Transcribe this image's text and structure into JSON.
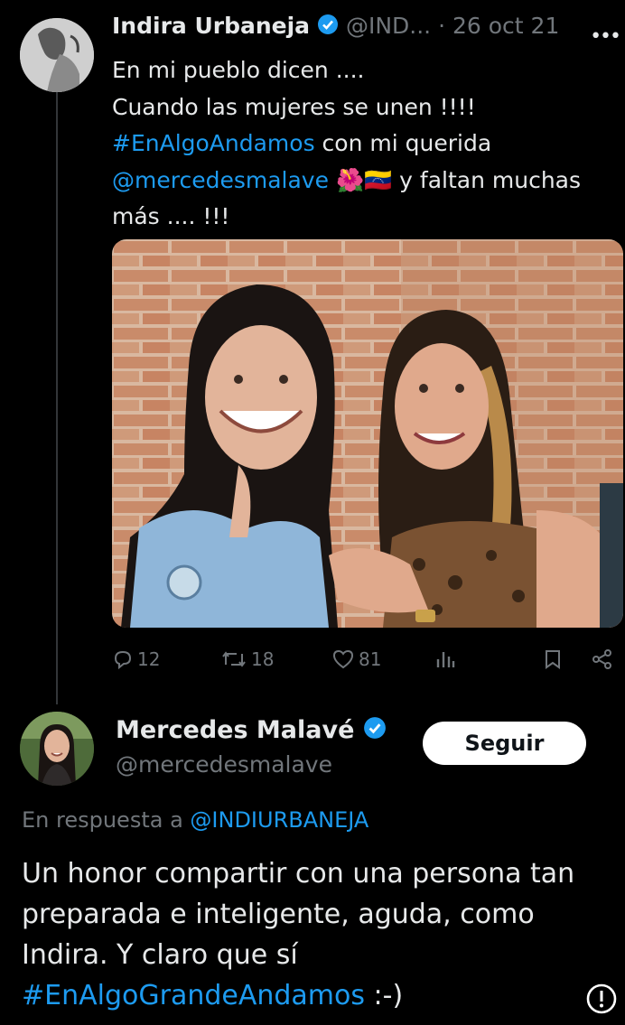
{
  "tweet": {
    "author_name": "Indira Urbaneja",
    "author_handle": "@IND...",
    "date": "· 26 oct 21",
    "lines": [
      {
        "text": "En mi pueblo dicen ...."
      },
      {
        "text": "Cuando las mujeres se unen !!!!"
      },
      {
        "hashtag": "#EnAlgoAndamos",
        "text": " con mi querida"
      },
      {
        "mention": "@mercedesmalave",
        "emoji": "🌺🇻🇪",
        "text": " y faltan muchas"
      },
      {
        "text": "más .... !!!"
      }
    ],
    "stats": {
      "replies": "12",
      "retweets": "18",
      "likes": "81"
    }
  },
  "reply": {
    "author_name": "Mercedes Malavé",
    "author_handle": "@mercedesmalave",
    "follow_label": "Seguir",
    "in_reply_prefix": "En respuesta a ",
    "in_reply_handle": "@INDIURBANEJA",
    "text": "Un honor compartir con una persona tan preparada e inteligente, aguda, como Indira. Y claro que sí",
    "hashtag": "#EnAlgoGrandeAndamos",
    "suffix": " :-)"
  },
  "colors": {
    "background": "#000000",
    "link": "#1d9bf0",
    "muted": "#71767b",
    "verified": "#1d9bf0"
  },
  "icons": [
    "more-icon",
    "verified-icon",
    "reply-icon",
    "retweet-icon",
    "like-icon",
    "views-icon",
    "bookmark-icon",
    "share-icon",
    "info-icon"
  ]
}
